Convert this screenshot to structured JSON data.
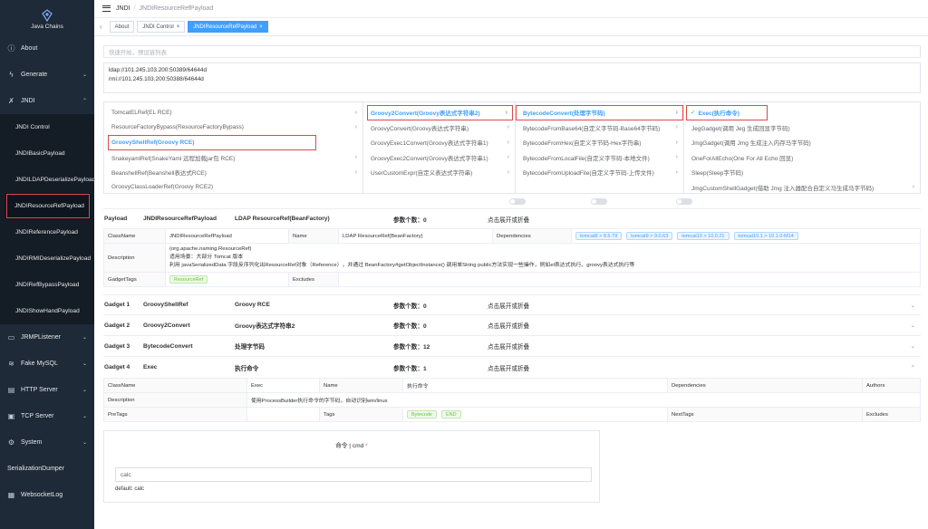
{
  "app": {
    "name": "Java Chains"
  },
  "sidebar": {
    "items": [
      {
        "label": "About",
        "icon": "info-icon"
      },
      {
        "label": "Generate",
        "icon": "lightning-icon"
      },
      {
        "label": "JNDI",
        "icon": "jndi-icon"
      }
    ],
    "jndi_children": [
      "JNDI Control",
      "JNDIBasicPayload",
      "JNDILDAPDeserializePayload",
      "JNDIResourceRefPayload",
      "JNDIReferencePayload",
      "JNDIRMIDeserializePayload",
      "JNDIRefBypassPayload",
      "JNDIShowHandPayload"
    ],
    "lower_items": [
      {
        "label": "JRMPListener",
        "icon": "listener-icon"
      },
      {
        "label": "Fake MySQL",
        "icon": "database-icon"
      },
      {
        "label": "HTTP Server",
        "icon": "server-icon"
      },
      {
        "label": "TCP Server",
        "icon": "monitor-icon"
      },
      {
        "label": "System",
        "icon": "gear-icon"
      },
      {
        "label": "SerializationDumper",
        "icon": ""
      },
      {
        "label": "WebsocketLog",
        "icon": "log-icon"
      }
    ]
  },
  "header": {
    "breadcrumb1": "JNDI",
    "breadcrumb2": "JNDIResourceRefPayload"
  },
  "tabs": [
    "About",
    "JNDI Control",
    "JNDIResourceRefPayload"
  ],
  "search": {
    "placeholder": "快速开始，预设链列表"
  },
  "urls": [
    "ldap://101.245.103.200:50389/64644d",
    "rmi://101.245.103.200:50388/64644d"
  ],
  "cascader": {
    "col1": [
      "TomcatELRef(EL RCE)",
      "ResourceFactoryBypass(ResourceFactoryBypass)",
      "GroovyShellRef(Groovy RCE)",
      "SnakeyamlRef(SnakeYaml 远程加载jar包 RCE)",
      "BeanshellRef(Beanshell表达式RCE)",
      "GroovyClassLoaderRef(Groovy RCE2)"
    ],
    "col2": [
      "Groovy2Convert(Groovy表达式字符串2)",
      "GroovyConvert(Groovy表达式字符串)",
      "GroovyExec1Convert(Groovy表达式字符串1)",
      "GroovyExec2Convert(Groovy表达式字符串1)",
      "UserCustomExpr(自定义表达式字符串)"
    ],
    "col3": [
      "BytecodeConvert(处理字节码)",
      "BytecodeFromBase64(自定义字节码-Base64字节码)",
      "BytecodeFromHex(自定义字节码-Hex字符串)",
      "BytecodeFromLocalFile(自定义字节码-本地文件)",
      "BytecodeFromUploadFile(自定义字节码-上传文件)"
    ],
    "col4": [
      "Exec(执行命令)",
      "JegGadget(调用 Jeg 生成回显字节码)",
      "JmgGadget(调用 Jmg 生成注入内存马字节码)",
      "OneForAllEcho(One For All Echo 回显)",
      "Sleep(Sleep字节码)",
      "JmgCustomShellGadget(借助 Jmg 注入器配合自定义马生成马字节码)"
    ]
  },
  "payload": {
    "label": "Payload",
    "name": "JNDIResourceRefPayload",
    "desc": "LDAP ResourceRef(BeanFactory)",
    "param_count": "参数个数：0",
    "expand": "点击展开或折叠"
  },
  "detail": {
    "classname_label": "ClassName",
    "classname": "JNDIResourceRefPayload",
    "name_label": "Name",
    "name": "LDAP ResourceRef(BeanFactory)",
    "deps_label": "Dependencies",
    "deps": [
      "tomcat8 > 8.5.79",
      "tomcat9 > 9.0.63",
      "tomcat10 > 10.0.21",
      "tomcat10.1 > 10.1.0-M14"
    ],
    "description_label": "Description",
    "description": [
      "(org.apache.naming.ResourceRef)",
      "适用场景：大部分 Tomcat 版本",
      "利用 javaSerializedData 字段反序列化出ResourceRef对象（Reference），并通过 BeanFactory#getObjectInstance() 调用单String public方法实现一些操作，例如el表达式执行、groovy表达式执行等"
    ],
    "tags_label": "GadgetTags",
    "tags": [
      "ResourceRef"
    ],
    "excludes_label": "Excludes"
  },
  "gadgets": [
    {
      "label": "Gadget 1",
      "name": "GroovyShellRef",
      "desc": "Groovy RCE",
      "count": "参数个数：0",
      "expand": "点击展开或折叠"
    },
    {
      "label": "Gadget 2",
      "name": "Groovy2Convert",
      "desc": "Groovy表达式字符串2",
      "count": "参数个数：0",
      "expand": "点击展开或折叠"
    },
    {
      "label": "Gadget 3",
      "name": "BytecodeConvert",
      "desc": "处理字节码",
      "count": "参数个数：12",
      "expand": "点击展开或折叠"
    },
    {
      "label": "Gadget 4",
      "name": "Exec",
      "desc": "执行命令",
      "count": "参数个数：1",
      "expand": "点击展开或折叠"
    }
  ],
  "exec_detail": {
    "classname_label": "ClassName",
    "classname": "Exec",
    "name_label": "Name",
    "name": "执行命令",
    "deps_label": "Dependencies",
    "authors_label": "Authors",
    "description_label": "Description",
    "description": "使用ProcessBuilder执行命令的字节码，自动识别win/linux",
    "pretags_label": "PreTags",
    "tags_label": "Tags",
    "tags": [
      "Bytecode",
      "END"
    ],
    "nexttags_label": "NextTags",
    "excludes_label": "Excludes"
  },
  "command": {
    "title": "命令 | cmd",
    "required": "*",
    "value": "calc",
    "default": "default: calc"
  }
}
